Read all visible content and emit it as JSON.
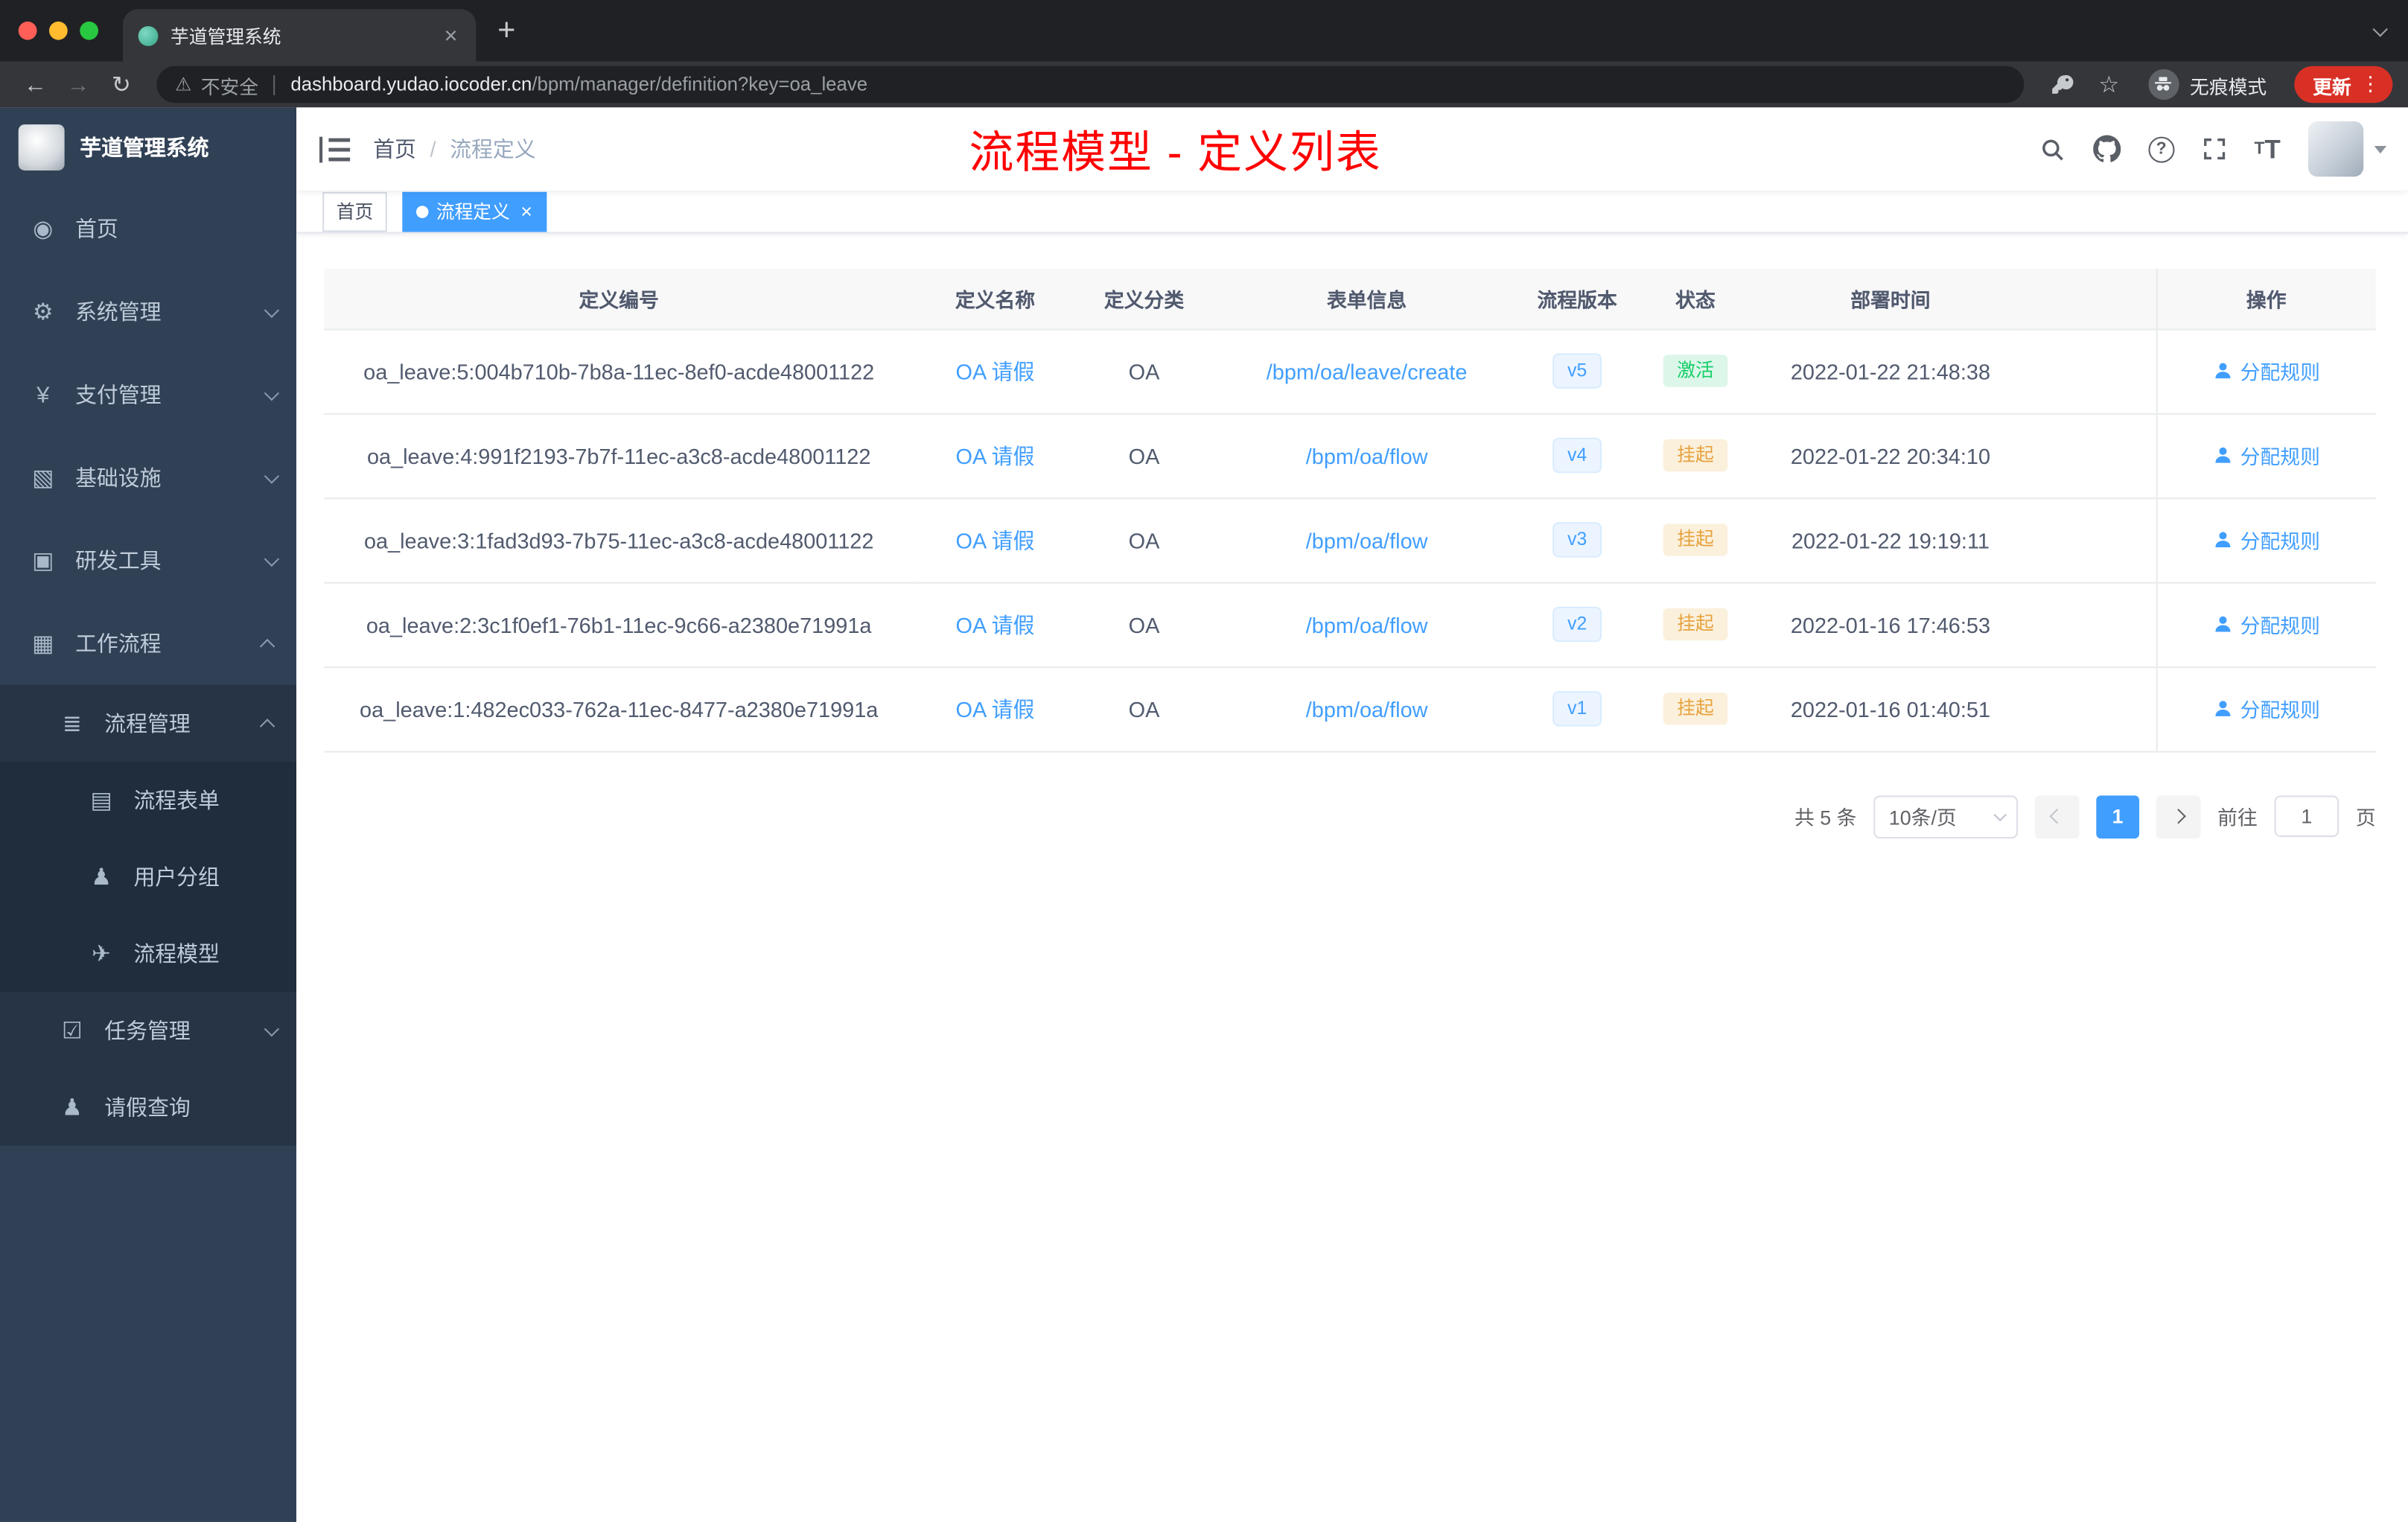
{
  "browser": {
    "tab_title": "芋道管理系统",
    "security_label": "不安全",
    "url_host": "dashboard.yudao.iocoder.cn",
    "url_path": "/bpm/manager/definition?key=oa_leave",
    "incognito_label": "无痕模式",
    "update_label": "更新"
  },
  "sidebar": {
    "app_title": "芋道管理系统",
    "items": [
      {
        "label": "首页"
      },
      {
        "label": "系统管理"
      },
      {
        "label": "支付管理"
      },
      {
        "label": "基础设施"
      },
      {
        "label": "研发工具"
      },
      {
        "label": "工作流程"
      },
      {
        "label": "流程管理"
      },
      {
        "label": "流程表单"
      },
      {
        "label": "用户分组"
      },
      {
        "label": "流程模型"
      },
      {
        "label": "任务管理"
      },
      {
        "label": "请假查询"
      }
    ]
  },
  "icons": {
    "home": "◉",
    "system": "⚙",
    "payment": "¥",
    "infrastructure": "▧",
    "devtools": "▣",
    "workflow": "▦",
    "process_mgmt": "≣",
    "process_form": "▤",
    "user_group": "♟",
    "process_model": "✈",
    "task_mgmt": "☑",
    "leave_query": "♟"
  },
  "navbar": {
    "breadcrumb_home": "首页",
    "breadcrumb_sep": "/",
    "breadcrumb_current": "流程定义",
    "annotation": "流程模型 - 定义列表"
  },
  "tags": {
    "items": [
      {
        "label": "首页"
      },
      {
        "label": "流程定义"
      }
    ]
  },
  "table": {
    "columns": [
      "定义编号",
      "定义名称",
      "定义分类",
      "表单信息",
      "流程版本",
      "状态",
      "部署时间",
      "操作"
    ],
    "rows": [
      {
        "id": "oa_leave:5:004b710b-7b8a-11ec-8ef0-acde48001122",
        "name": "OA 请假",
        "category": "OA",
        "form": "/bpm/oa/leave/create",
        "version": "v5",
        "status": "激活",
        "time": "2022-01-22 21:48:38",
        "action": "分配规则"
      },
      {
        "id": "oa_leave:4:991f2193-7b7f-11ec-a3c8-acde48001122",
        "name": "OA 请假",
        "category": "OA",
        "form": "/bpm/oa/flow",
        "version": "v4",
        "status": "挂起",
        "time": "2022-01-22 20:34:10",
        "action": "分配规则"
      },
      {
        "id": "oa_leave:3:1fad3d93-7b75-11ec-a3c8-acde48001122",
        "name": "OA 请假",
        "category": "OA",
        "form": "/bpm/oa/flow",
        "version": "v3",
        "status": "挂起",
        "time": "2022-01-22 19:19:11",
        "action": "分配规则"
      },
      {
        "id": "oa_leave:2:3c1f0ef1-76b1-11ec-9c66-a2380e71991a",
        "name": "OA 请假",
        "category": "OA",
        "form": "/bpm/oa/flow",
        "version": "v2",
        "status": "挂起",
        "time": "2022-01-16 17:46:53",
        "action": "分配规则"
      },
      {
        "id": "oa_leave:1:482ec033-762a-11ec-8477-a2380e71991a",
        "name": "OA 请假",
        "category": "OA",
        "form": "/bpm/oa/flow",
        "version": "v1",
        "status": "挂起",
        "time": "2022-01-16 01:40:51",
        "action": "分配规则"
      }
    ]
  },
  "pagination": {
    "total": "共 5 条",
    "page_size": "10条/页",
    "current_page": "1",
    "goto_label": "前往",
    "goto_value": "1",
    "page_unit": "页"
  },
  "colors": {
    "accent": "#409eff",
    "sidebar_bg": "#304156",
    "annotation_red": "#ff0000",
    "status_active": "#13ce66",
    "status_suspend": "#e6a23c"
  }
}
